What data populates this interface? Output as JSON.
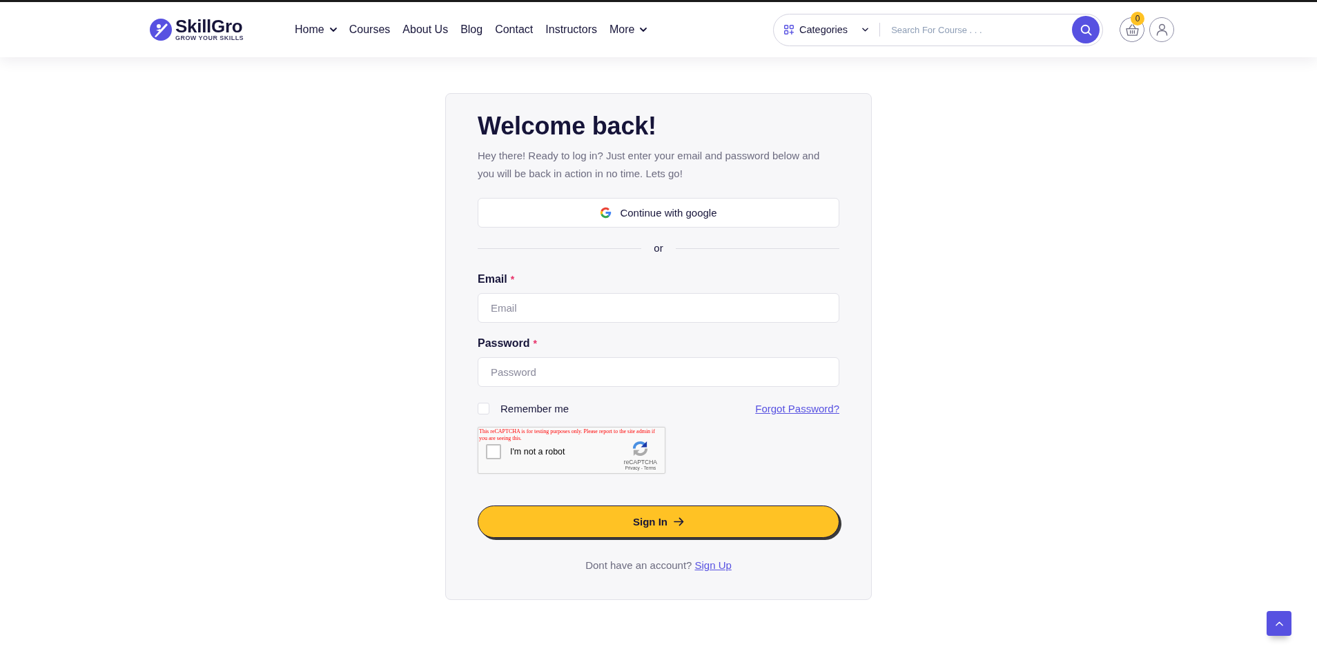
{
  "header": {
    "logo": {
      "name": "SkillGro",
      "tagline": "GROW YOUR SKILLS"
    },
    "nav": [
      {
        "label": "Home",
        "dropdown": true
      },
      {
        "label": "Courses",
        "dropdown": false
      },
      {
        "label": "About Us",
        "dropdown": false
      },
      {
        "label": "Blog",
        "dropdown": false
      },
      {
        "label": "Contact",
        "dropdown": false
      },
      {
        "label": "Instructors",
        "dropdown": false
      },
      {
        "label": "More",
        "dropdown": true
      }
    ],
    "search": {
      "category": "Categories",
      "placeholder": "Search For Course . . ."
    },
    "cart": {
      "count": "0"
    }
  },
  "login": {
    "title": "Welcome back!",
    "intro": "Hey there! Ready to log in? Just enter your email and password below and you will be back in action in no time. Lets go!",
    "google_button": "Continue with google",
    "divider": "or",
    "fields": [
      {
        "label": "Email",
        "required_mark": "*",
        "placeholder": "Email"
      },
      {
        "label": "Password",
        "required_mark": "*",
        "placeholder": "Password"
      }
    ],
    "remember": {
      "label": "Remember me",
      "checked": false
    },
    "forgot_link": "Forgot Password?",
    "recaptcha": {
      "warning": "This reCAPTCHA is for testing purposes only. Please report to the site admin if you are seeing this.",
      "label": "I'm not a robot",
      "checked": false,
      "brand": "reCAPTCHA",
      "legal": "Privacy - Terms"
    },
    "submit": "Sign In",
    "signup": {
      "prompt": "Dont have an account?",
      "link": "Sign Up"
    }
  }
}
